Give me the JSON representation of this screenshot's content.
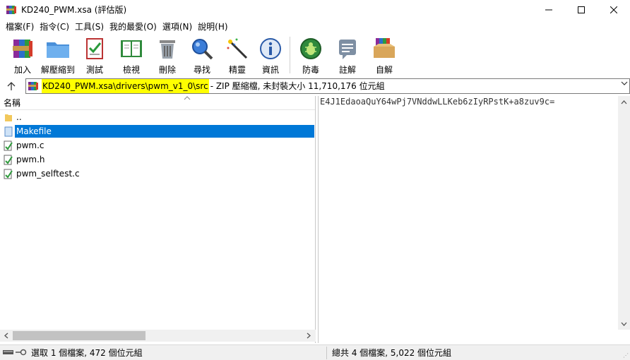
{
  "window": {
    "title": "KD240_PWM.xsa (評估版)",
    "controls": {
      "minimize": "—",
      "maximize": "☐",
      "close": "✕"
    }
  },
  "menu": [
    "檔案(F)",
    "指令(C)",
    "工具(S)",
    "我的最愛(O)",
    "選項(N)",
    "說明(H)"
  ],
  "toolbar": {
    "add": "加入",
    "extract": "解壓縮到",
    "test": "測試",
    "view": "檢視",
    "delete": "刪除",
    "find": "尋找",
    "wizard": "精靈",
    "info": "資訊",
    "virus": "防毒",
    "comment": "註解",
    "sfx": "自解"
  },
  "address": {
    "path": "KD240_PWM.xsa\\drivers\\pwm_v1_0\\src",
    "info": " - ZIP 壓縮檔, 未封裝大小 11,710,176 位元組"
  },
  "file_list": {
    "column_name": "名稱",
    "items": [
      {
        "name": "..",
        "type": "folder-up"
      },
      {
        "name": "Makefile",
        "type": "file",
        "selected": true
      },
      {
        "name": "pwm.c",
        "type": "source"
      },
      {
        "name": "pwm.h",
        "type": "source"
      },
      {
        "name": "pwm_selftest.c",
        "type": "source"
      }
    ]
  },
  "comment": "E4J1EdaoaQuY64wPj7VNddwLLKeb6zIyRPstK+a8zuv9c=",
  "status": {
    "left": "選取 1 個檔案, 472 個位元組",
    "right": "總共 4 個檔案, 5,022 個位元組"
  },
  "colors": {
    "selection": "#0078d7",
    "path_highlight": "#ffff00"
  }
}
